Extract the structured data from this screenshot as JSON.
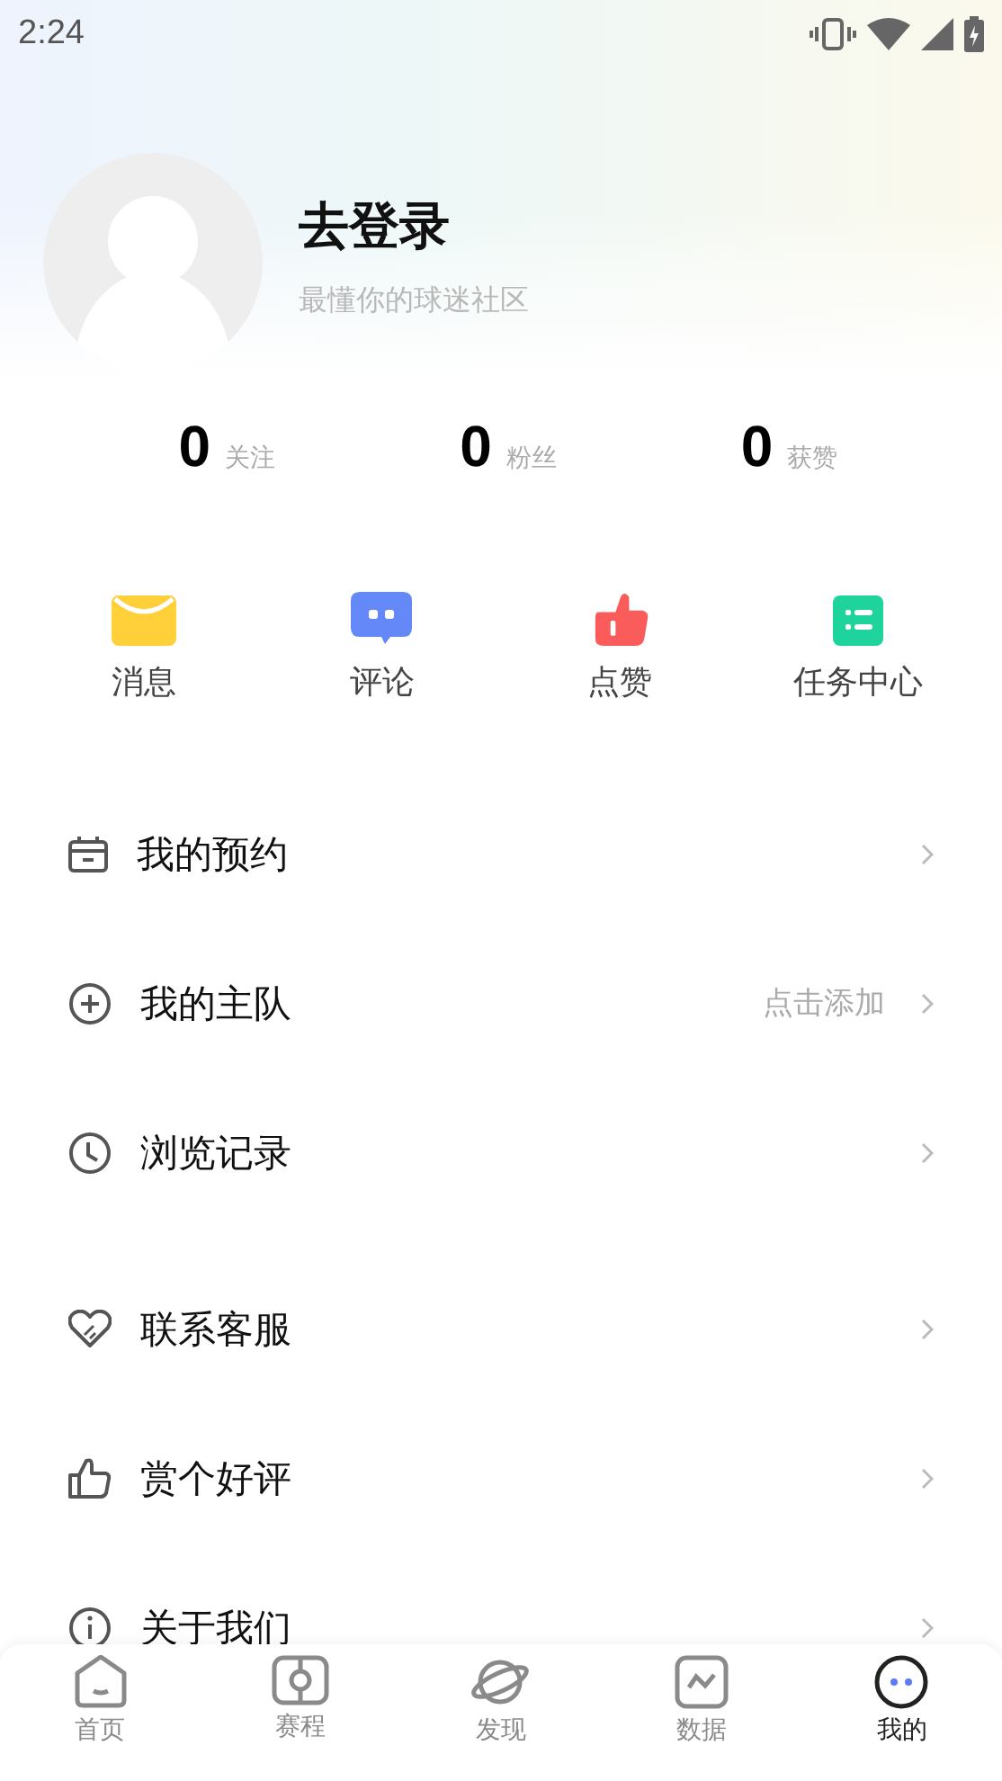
{
  "status_bar": {
    "time": "2:24"
  },
  "profile": {
    "name": "去登录",
    "tagline": "最懂你的球迷社区"
  },
  "stats": [
    {
      "value": "0",
      "label": "关注"
    },
    {
      "value": "0",
      "label": "粉丝"
    },
    {
      "value": "0",
      "label": "获赞"
    }
  ],
  "shortcuts": [
    {
      "kind": "mail",
      "label": "消息",
      "color": "#ffd03a"
    },
    {
      "kind": "comment",
      "label": "评论",
      "color": "#6488f7"
    },
    {
      "kind": "like",
      "label": "点赞",
      "color": "#fa5c5c"
    },
    {
      "kind": "task",
      "label": "任务中心",
      "color": "#1ed39c"
    }
  ],
  "menu_groups": [
    [
      {
        "kind": "calendar",
        "label": "我的预约"
      },
      {
        "kind": "add",
        "label": "我的主队",
        "hint": "点击添加"
      },
      {
        "kind": "clock",
        "label": "浏览记录"
      }
    ],
    [
      {
        "kind": "heart",
        "label": "联系客服"
      },
      {
        "kind": "thumb",
        "label": "赏个好评"
      },
      {
        "kind": "info",
        "label": "关于我们"
      }
    ]
  ],
  "tabs": [
    {
      "kind": "home",
      "label": "首页",
      "selected": false
    },
    {
      "kind": "schedule",
      "label": "赛程",
      "selected": false
    },
    {
      "kind": "planet",
      "label": "发现",
      "selected": false
    },
    {
      "kind": "data",
      "label": "数据",
      "selected": false
    },
    {
      "kind": "me",
      "label": "我的",
      "selected": true
    }
  ]
}
